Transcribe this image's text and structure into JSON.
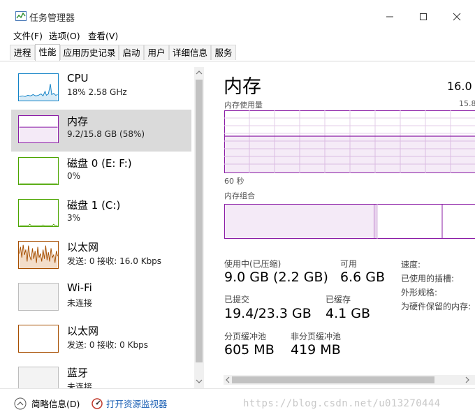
{
  "window": {
    "title": "任务管理器"
  },
  "menu": [
    "文件(F)",
    "选项(O)",
    "查看(V)"
  ],
  "tabs": [
    "进程",
    "性能",
    "应用历史记录",
    "启动",
    "用户",
    "详细信息",
    "服务"
  ],
  "active_tab": 1,
  "sidebar": [
    {
      "title": "CPU",
      "sub": "18%  2.58 GHz",
      "color": "#1383c7",
      "selected": false
    },
    {
      "title": "内存",
      "sub": "9.2/15.8 GB (58%)",
      "color": "#8b1ca6",
      "selected": true
    },
    {
      "title": "磁盘 0 (E: F:)",
      "sub": "0%",
      "color": "#4ca500",
      "selected": false
    },
    {
      "title": "磁盘 1 (C:)",
      "sub": "3%",
      "color": "#4ca500",
      "selected": false
    },
    {
      "title": "以太网",
      "sub": "发送: 0  接收: 16.0 Kbps",
      "color": "#a74f01",
      "selected": false
    },
    {
      "title": "Wi-Fi",
      "sub": "未连接",
      "color": "#a74f01",
      "selected": false
    },
    {
      "title": "以太网",
      "sub": "发送: 0  接收: 0 Kbps",
      "color": "#a74f01",
      "selected": false
    },
    {
      "title": "蓝牙",
      "sub": "未连接",
      "color": "#a74f01",
      "selected": false
    }
  ],
  "main": {
    "title": "内存",
    "total": "16.0",
    "usage_label": "内存使用量",
    "usage_max": "15.8",
    "time_label": "60 秒",
    "composition_label": "内存组合",
    "used_fraction": 0.58,
    "stats": {
      "in_use_label": "使用中(已压缩)",
      "in_use_value": "9.0 GB (2.2 GB)",
      "available_label": "可用",
      "available_value": "6.6 GB",
      "committed_label": "已提交",
      "committed_value": "19.4/23.3 GB",
      "cached_label": "已缓存",
      "cached_value": "4.1 GB",
      "paged_label": "分页缓冲池",
      "paged_value": "605 MB",
      "nonpaged_label": "非分页缓冲池",
      "nonpaged_value": "419 MB"
    },
    "right": {
      "speed_label": "速度:",
      "slots_label": "已使用的插槽:",
      "form_label": "外形规格:",
      "reserved_label": "为硬件保留的内存:"
    }
  },
  "footer": {
    "less_details": "简略信息(D)",
    "resource_monitor": "打开资源监视器"
  },
  "watermark": "https://blog.csdn.net/u013270444"
}
